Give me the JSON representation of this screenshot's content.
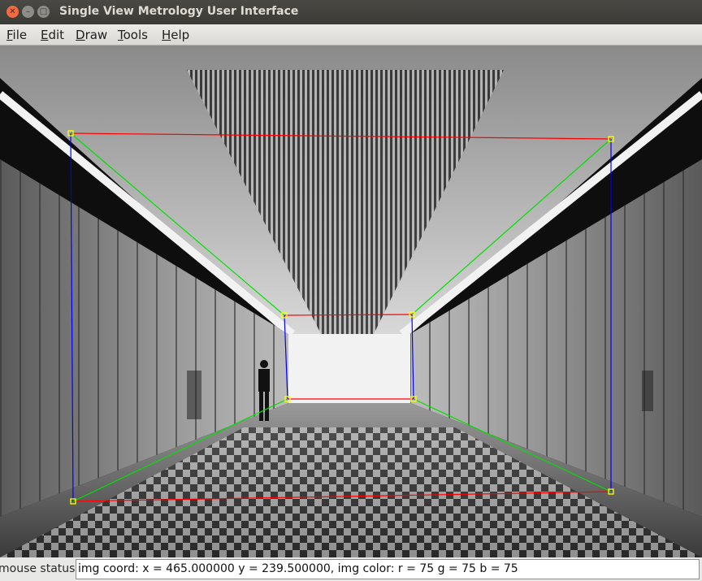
{
  "window": {
    "title": "Single View Metrology User Interface"
  },
  "menu": [
    "File",
    "Edit",
    "Draw",
    "Tools",
    "Help"
  ],
  "status": {
    "label": "mouse status:",
    "value": "img coord: x = 465.000000 y = 239.500000, img color: r = 75 g = 75 b = 75"
  },
  "annotation_colors": {
    "horizontal": "#ff0000",
    "vertical": "#0000ff",
    "depth": "#00e000",
    "handle": "#ffff00"
  }
}
